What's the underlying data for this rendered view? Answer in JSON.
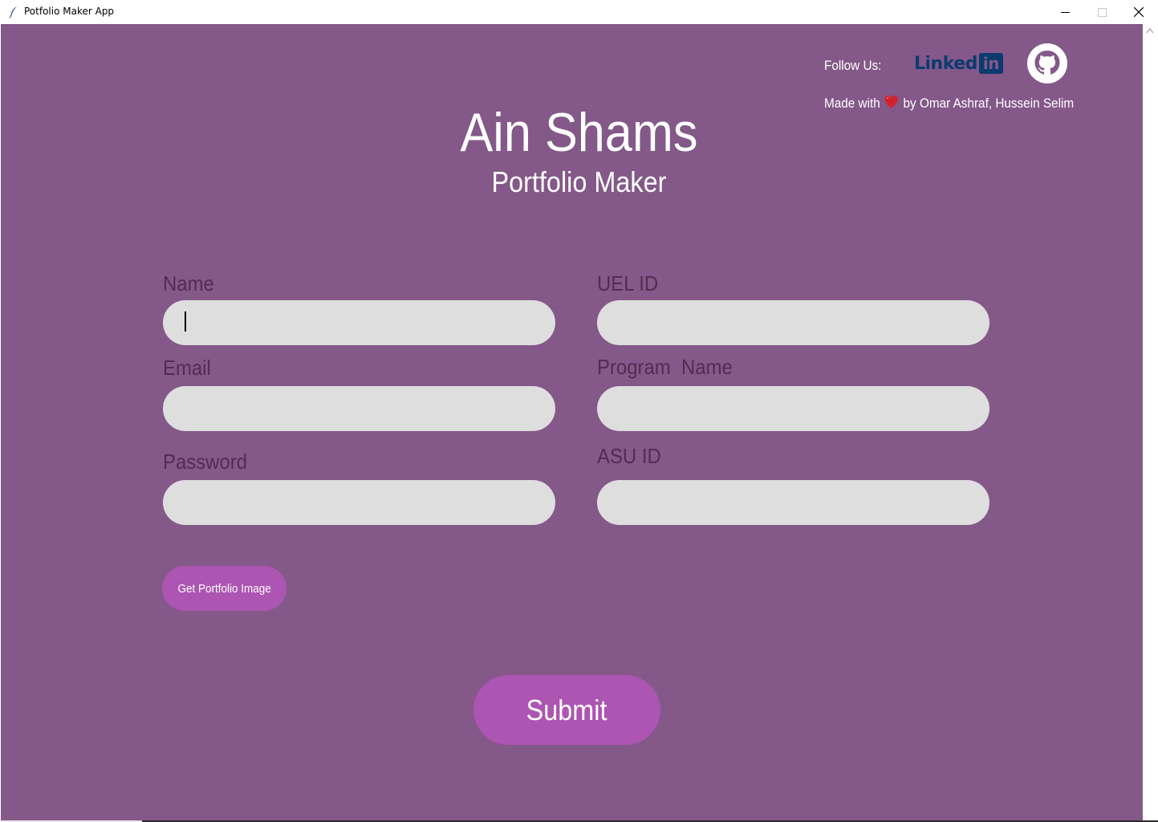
{
  "window": {
    "title": "Potfolio Maker App"
  },
  "header": {
    "follow_label": "Follow Us:",
    "linkedin_text": "Linked",
    "linkedin_box_text": "in",
    "credits_prefix": "Made with",
    "credits_suffix": "by Omar Ashraf, Hussein Selim"
  },
  "hero": {
    "title": "Ain Shams",
    "subtitle": "Portfolio Maker"
  },
  "form": {
    "name_label": "Name",
    "name_value": "",
    "email_label": "Email",
    "email_value": "",
    "password_label": "Password",
    "password_value": "",
    "uel_label": "UEL ID",
    "uel_value": "",
    "program_label": "Program  Name",
    "program_value": "",
    "asu_label": "ASU ID",
    "asu_value": ""
  },
  "actions": {
    "image_button_label": "Get Portfolio Image",
    "submit_label": "Submit"
  },
  "colors": {
    "background": "#845889",
    "label": "#532c52",
    "input_bg": "#dedede",
    "button": "#ac55b2",
    "linkedin": "#0a3b6f",
    "heart": "#d2232a"
  },
  "icons": {
    "app": "feather-icon",
    "social": [
      "linkedin-icon",
      "github-icon"
    ],
    "heart": "heart-icon"
  }
}
